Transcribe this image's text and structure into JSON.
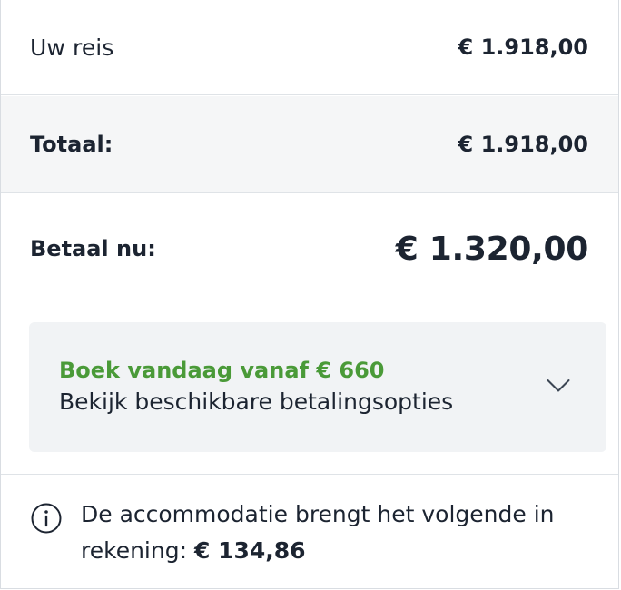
{
  "summary": {
    "trip_label": "Uw reis",
    "trip_amount": "€ 1.918,00",
    "total_label": "Totaal:",
    "total_amount": "€ 1.918,00",
    "pay_now_label": "Betaal nu:",
    "pay_now_amount": "€ 1.320,00"
  },
  "payment_options": {
    "title": "Boek vandaag vanaf € 660",
    "subtitle": "Bekijk beschikbare betalingsopties",
    "expand_icon": "chevron-down-icon"
  },
  "note": {
    "icon": "info-icon",
    "text": "De accommodatie brengt het volgende in rekening:",
    "amount": "€ 134,86"
  },
  "colors": {
    "accent_green": "#4a9a38",
    "text": "#1c2431",
    "total_bg": "#f5f6f7",
    "options_bg": "#f1f3f5"
  }
}
